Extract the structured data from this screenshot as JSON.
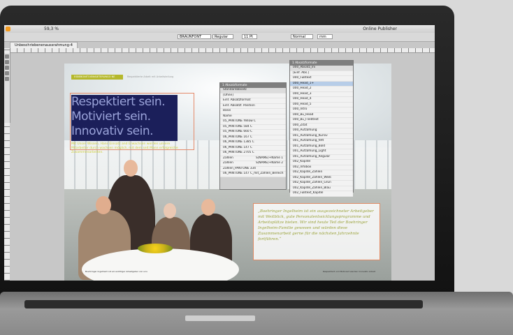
{
  "app": {
    "menubar": {
      "zoom": "59,3 %",
      "publisher": "Online Publisher"
    },
    "control": {
      "font_name": "BRAUNFONT",
      "font_style": "Regular",
      "size": "11 Pt",
      "style_right": "Normal",
      "units": "mm"
    },
    "document_tab": "Unbeschriebenenaussrahmung-4"
  },
  "page": {
    "header_label": "ESBEBONITOIEINSIETERUNGO NE",
    "header_right": "Respektierte Arbeit mit Arbeitsteilung",
    "headline": [
      "Respektiert sein.",
      "Motiviert sein.",
      "Innovativ sein."
    ],
    "subtitle": "Mit Unser Wissen, Hans Einsatz and Erwachsen werden unsere Mitarbeiter durch wachsen möglich, mit dem seit Mann erfolgreiche Zusammenarbeiten.",
    "quote": "„Boehringer Ingelheim ist ein ausgezeichneter Arbeitgeber mit Weitblick, gute Personalentwicklungsprogramme und Arbeitsplätze bieten. Wir sind heute Teil der Boehringer Ingelheim-Familie gewesen und würden diese Zusammenarbeit gerne für die nächsten Jahrzehnte fortführen.“",
    "caption_left": "Boehringer Ingelheim ist ein wichtiger Arbeitgeber von uns",
    "caption_right": "Respektiert und Motiviert werden Innovativ Arbeit"
  },
  "paragraph_panel": {
    "title": "1 Absatzformate",
    "header": "Standardabsatz",
    "rows": [
      {
        "label": "[Ohne]",
        "right": ""
      },
      {
        "label": "Einf. Absatzformat",
        "right": ""
      },
      {
        "label": "Einf. Absatzf. Position",
        "right": ""
      },
      {
        "label": "Basis",
        "right": ""
      },
      {
        "label": "Name",
        "right": ""
      },
      {
        "label": "05_PANTONE Yellow C",
        "right": ""
      },
      {
        "label": "05_PANTONE 584 C",
        "right": ""
      },
      {
        "label": "05_PANTONE 660 C",
        "right": ""
      },
      {
        "label": "06_PANTONE 167 C",
        "right": ""
      },
      {
        "label": "06_PANTONE 1385 C",
        "right": ""
      },
      {
        "label": "06_PANTONE 147 C",
        "right": ""
      },
      {
        "label": "06_PANTONE 2705 C",
        "right": ""
      },
      {
        "label": "Zahlen",
        "right": "S(NAME)+Name 1"
      },
      {
        "label": "Zahlen",
        "right": "S(NAME)+Name 2"
      },
      {
        "label": "Zahlen_PANTONE 334",
        "right": ""
      },
      {
        "label": "06_PANTONE 147 C_mit_Zahlen_Bereich",
        "right": ""
      }
    ]
  },
  "object_panel": {
    "title": "1 Absatzformate",
    "header": "000_Absatz_Ini",
    "rows": [
      "[Einf. Abs.]",
      "000_Fußtext",
      "000_Head_1+",
      "000_Head_2",
      "000_Head_3",
      "000_Head_4",
      "000_Head_5",
      "000_Intro",
      "000_Bu_Head",
      "000_Bu_Fließtext",
      "000_Zitat",
      "000_Aufzählung",
      "001_Aufzählung_Kursiv",
      "001_Aufzählung_fett",
      "001_Aufzählung_Bold",
      "001_Aufzählung_Light",
      "001_Aufzählung_Regular",
      "002_Kapitel",
      "002_Infobox",
      "002_Kapitel_Zahlen",
      "002_Kapitel_Zahlen_Weiß",
      "002_Kapitel_Zahlen_Grün",
      "002_Kapitel_Zahlen_Blau",
      "002_Fußtext_Kapitel"
    ],
    "selected_index": 2
  },
  "colors": {
    "headline_box": "#1b1f5a",
    "headline_text": "#9aa3d9",
    "accent_green": "#b5b82c",
    "frame_orange": "#e48a6a",
    "quote_text": "#9aa23a"
  },
  "icons": [
    "app-logo-icon",
    "selection-tool-icon",
    "direct-selection-icon",
    "text-tool-icon",
    "pen-tool-icon",
    "rectangle-tool-icon"
  ]
}
